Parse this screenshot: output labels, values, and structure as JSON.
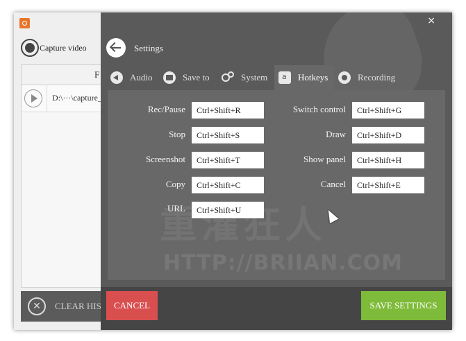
{
  "background_app": {
    "capture_label": "Capture video",
    "list_header_initial": "F",
    "row_path": "D:\\···\\capture_",
    "clear_label": "CLEAR HIS"
  },
  "settings": {
    "title": "Settings",
    "close_glyph": "×",
    "tabs": [
      {
        "label": "Audio",
        "icon": "speaker-icon"
      },
      {
        "label": "Save to",
        "icon": "folder-icon"
      },
      {
        "label": "System",
        "icon": "gears-icon"
      },
      {
        "label": "Hotkeys",
        "icon": "keyboard-key-icon",
        "active": true
      },
      {
        "label": "Recording",
        "icon": "record-icon"
      }
    ],
    "hotkeys_left": [
      {
        "label": "Rec/Pause",
        "value": "Ctrl+Shift+R"
      },
      {
        "label": "Stop",
        "value": "Ctrl+Shift+S"
      },
      {
        "label": "Screenshot",
        "value": "Ctrl+Shift+T"
      },
      {
        "label": "Copy",
        "value": "Ctrl+Shift+C"
      },
      {
        "label": "URL",
        "value": "Ctrl+Shift+U"
      }
    ],
    "hotkeys_right": [
      {
        "label": "Switch control",
        "value": "Ctrl+Shift+G"
      },
      {
        "label": "Draw",
        "value": "Ctrl+Shift+D"
      },
      {
        "label": "Show panel",
        "value": "Ctrl+Shift+H"
      },
      {
        "label": "Cancel",
        "value": "Ctrl+Shift+E"
      }
    ],
    "watermark_cn": "重灌狂人",
    "watermark_url": "HTTP://BRIIAN.COM",
    "cancel_label": "CANCEL",
    "save_label": "SAVE SETTINGS"
  },
  "colors": {
    "overlay": "#5a5a5a",
    "panel": "#686868",
    "cancel": "#d94f4f",
    "save": "#7fbb3a"
  }
}
